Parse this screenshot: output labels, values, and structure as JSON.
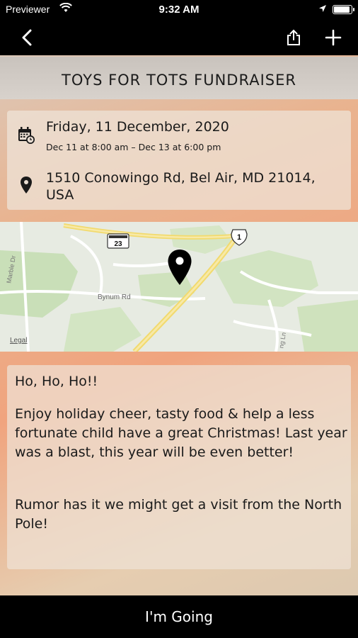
{
  "status_bar": {
    "carrier": "Previewer",
    "time": "9:32 AM"
  },
  "nav": {
    "back_icon": "chevron-left-icon",
    "share_icon": "share-icon",
    "add_icon": "plus-icon"
  },
  "event": {
    "title": "TOYS FOR TOTS FUNDRAISER",
    "date": "Friday, 11 December, 2020",
    "date_range": "Dec 11 at 8:00 am – Dec 13 at 6:00 pm",
    "address": "1510 Conowingo Rd,  Bel Air, MD 21014, USA"
  },
  "map": {
    "route_23": "23",
    "route_1": "1",
    "road_bynum": "Bynum Rd",
    "road_left": "Marble Dr",
    "road_right": "ng Ln",
    "legal": "Legal"
  },
  "description": {
    "p1": "Ho, Ho, Ho!!",
    "p2": "Enjoy holiday cheer, tasty food & help a less fortunate child have a great Christmas! Last year was a blast, this year will be even better!",
    "p3": "Rumor has it we might get a visit from the North Pole!"
  },
  "action": {
    "going_label": "I'm Going"
  }
}
